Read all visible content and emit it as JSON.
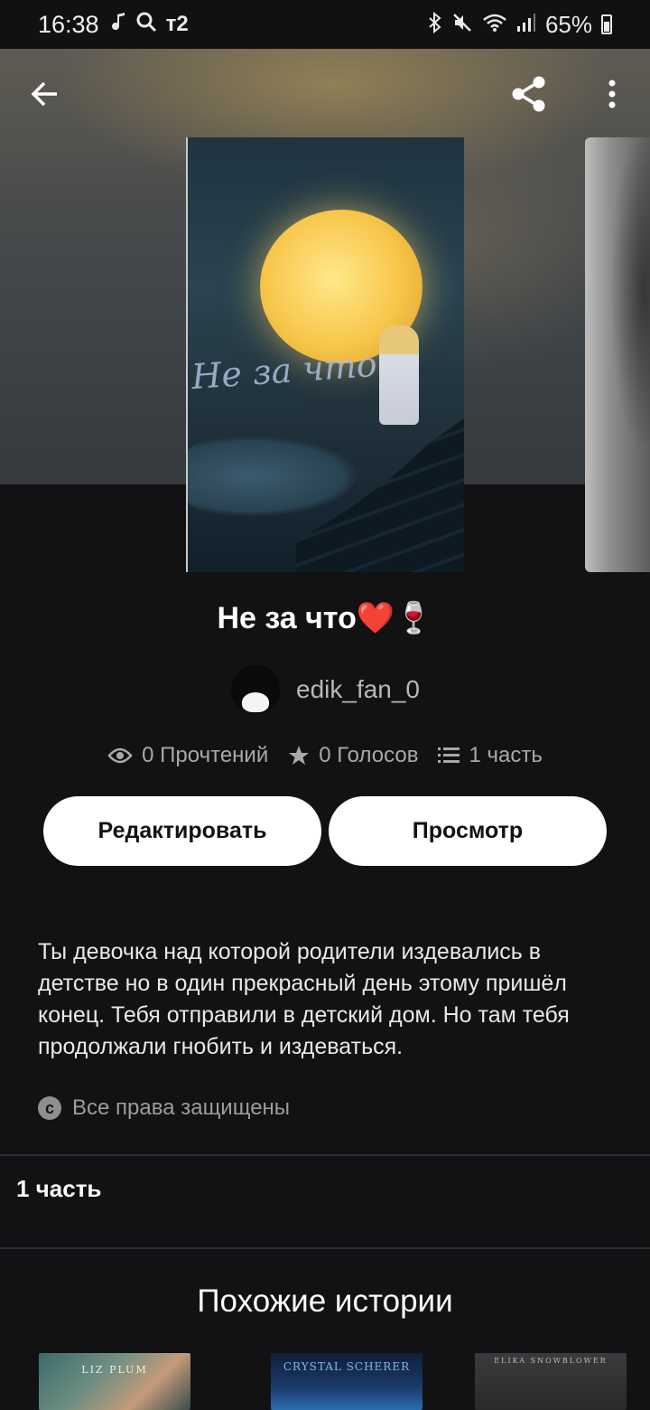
{
  "status_bar": {
    "time": "16:38",
    "left_icons": [
      "music-note-icon",
      "search-icon",
      "carrier-t2-icon"
    ],
    "carrier_label": "т2",
    "right_icons": [
      "bluetooth-icon",
      "mute-icon",
      "wifi-icon",
      "signal-icon",
      "battery-icon"
    ],
    "battery": "65%"
  },
  "toolbar": {
    "back_icon": "arrow-left-icon",
    "share_icon": "share-icon",
    "more_icon": "more-vertical-icon"
  },
  "cover": {
    "title_text": "Не за что"
  },
  "story": {
    "title": "Не за что❤️🍷",
    "author": "edik_fan_0",
    "stats": {
      "reads": "0 Прочтений",
      "votes": "0 Голосов",
      "parts": "1 часть"
    },
    "edit_label": "Редактировать",
    "preview_label": "Просмотр",
    "description": "Ты девочка над которой родители издевались в детстве но в один прекрасный день этому пришёл конец. Тебя отправили в детский дом. Но там тебя продолжали гнобить и издеваться.",
    "rights": "Все права защищены",
    "copyright_glyph": "c"
  },
  "parts_section": {
    "label": "1 часть"
  },
  "similar": {
    "title": "Похожие истории",
    "items": [
      {
        "label": "LIZ PLUM"
      },
      {
        "label": "CRYSTAL SCHERER"
      },
      {
        "label": "ELIKA SNOWBLOWER"
      }
    ]
  }
}
